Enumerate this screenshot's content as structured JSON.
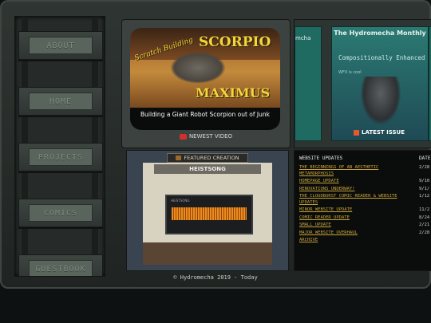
{
  "sidebar": {
    "items": [
      {
        "label": "ABOUT"
      },
      {
        "label": "HOME"
      },
      {
        "label": "PROJECTS"
      },
      {
        "label": "COMICS"
      },
      {
        "label": "GUESTBOOK"
      }
    ]
  },
  "video": {
    "art_title_1": "SCORPIO",
    "art_title_2": "Scratch Building",
    "art_title_3": "MAXIMUS",
    "caption": "Building a Giant Robot Scorpion out of Junk",
    "label": "NEWEST VIDEO"
  },
  "comic": {
    "left_cover_title": "mcha",
    "title": "The Hydromecha Monthly",
    "subtitle": "Compositionally Enhanced",
    "tagline": "WFX is cool",
    "label": "LATEST ISSUE"
  },
  "featured": {
    "label": "FEATURED CREATION",
    "name": "HEISTSONG",
    "player_title": "HEISTSONG"
  },
  "updates": {
    "header": "WEBSITE UPDATES",
    "date_header": "DATE",
    "items": [
      {
        "title": "THE BEGINNINGS OF AN AESTHETIC METAMORPHOSIS",
        "date": "2/28"
      },
      {
        "title": "HOMEPAGE UPDATE",
        "date": "9/10"
      },
      {
        "title": "RENOVATIONS UNDERWAY!",
        "date": "9/1/"
      },
      {
        "title": "THE CLOUDBURST COMIC READER & WEBSITE UPDATES",
        "date": "1/12"
      },
      {
        "title": "MINOR WEBSITE UPDATE",
        "date": "11/2"
      },
      {
        "title": "COMIC READER UPDATE",
        "date": "8/24"
      },
      {
        "title": "SMALL UPDATE",
        "date": "2/21"
      },
      {
        "title": "MAJOR WEBSITE OVERHAUL",
        "date": "2/28"
      },
      {
        "title": "ARCHIVE",
        "date": ""
      }
    ]
  },
  "footer": {
    "text": "© Hydromecha 2019 - Today"
  },
  "colors": {
    "link": "#c7a33a",
    "frame": "#2f3532",
    "panel": "#3b423f"
  }
}
